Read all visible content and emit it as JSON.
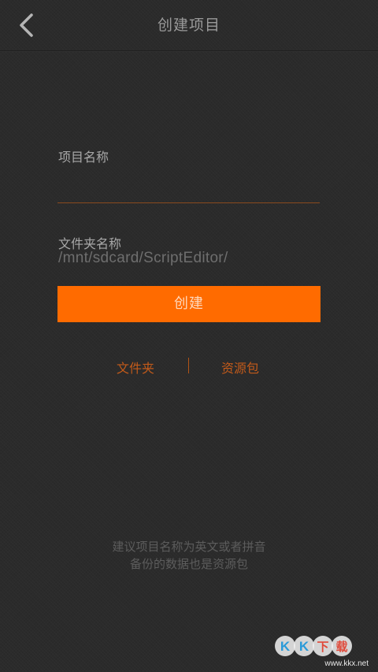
{
  "header": {
    "title": "创建项目",
    "back_icon": "chevron-left-icon"
  },
  "form": {
    "project_name_label": "项目名称",
    "project_name_value": "",
    "folder_name_label": "文件夹名称",
    "folder_path": "/mnt/sdcard/ScriptEditor/",
    "create_button": "创建"
  },
  "links": {
    "folder": "文件夹",
    "resource_package": "资源包"
  },
  "hint": {
    "line1": "建议项目名称为英文或者拼音",
    "line2": "备份的数据也是资源包"
  },
  "watermark": {
    "text": "www.kkx.net",
    "logo_text": "KK下载"
  },
  "colors": {
    "accent": "#ff6b00",
    "background": "#2b2b2b",
    "link": "#c25a1a"
  }
}
